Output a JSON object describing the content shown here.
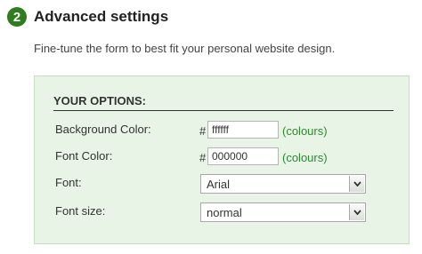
{
  "step": {
    "number": "2",
    "title": "Advanced settings"
  },
  "description": "Fine-tune the form to best fit your personal website design.",
  "options": {
    "heading": "YOUR OPTIONS:",
    "background_color": {
      "label": "Background Color:",
      "hash": "#",
      "value": "ffffff",
      "link": "(colours)"
    },
    "font_color": {
      "label": "Font Color:",
      "hash": "#",
      "value": "000000",
      "link": "(colours)"
    },
    "font": {
      "label": "Font:",
      "selected": "Arial"
    },
    "font_size": {
      "label": "Font size:",
      "selected": "normal"
    }
  },
  "colors": {
    "accent": "#2f7d1f",
    "panel_bg": "#e8f4e6",
    "link": "#2d8a2d"
  },
  "icons": {
    "select_arrow": "chevron-down-icon"
  }
}
